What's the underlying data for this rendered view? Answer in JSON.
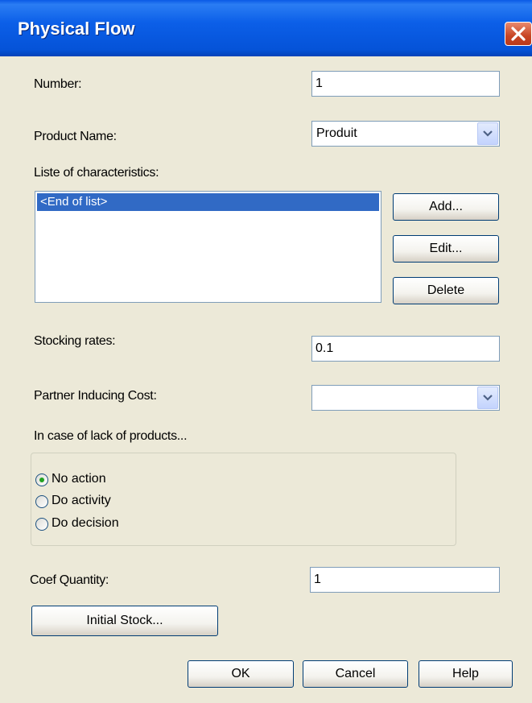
{
  "window": {
    "title": "Physical Flow",
    "close_icon": "close-icon"
  },
  "fields": {
    "number_label": "Number:",
    "number_value": "1",
    "product_label": "Product Name:",
    "product_value": "Produit",
    "list_label": "Liste of characteristics:",
    "list_items": [
      "<End of list>"
    ],
    "stocking_label": "Stocking rates:",
    "stocking_value": "0.1",
    "partner_label": "Partner Inducing Cost:",
    "partner_value": "",
    "lack_label": "In case of lack of products...",
    "coef_label": "Coef Quantity:",
    "coef_value": "1"
  },
  "radios": [
    {
      "label": "No action",
      "checked": true
    },
    {
      "label": "Do activity",
      "checked": false
    },
    {
      "label": "Do decision",
      "checked": false
    }
  ],
  "buttons": {
    "add": "Add...",
    "edit": "Edit...",
    "delete": "Delete",
    "initial_stock": "Initial Stock...",
    "ok": "OK",
    "cancel": "Cancel",
    "help": "Help"
  },
  "colors": {
    "titlebar": "#0553d8",
    "selection": "#316ac5",
    "dialog_bg": "#ece9d8"
  }
}
